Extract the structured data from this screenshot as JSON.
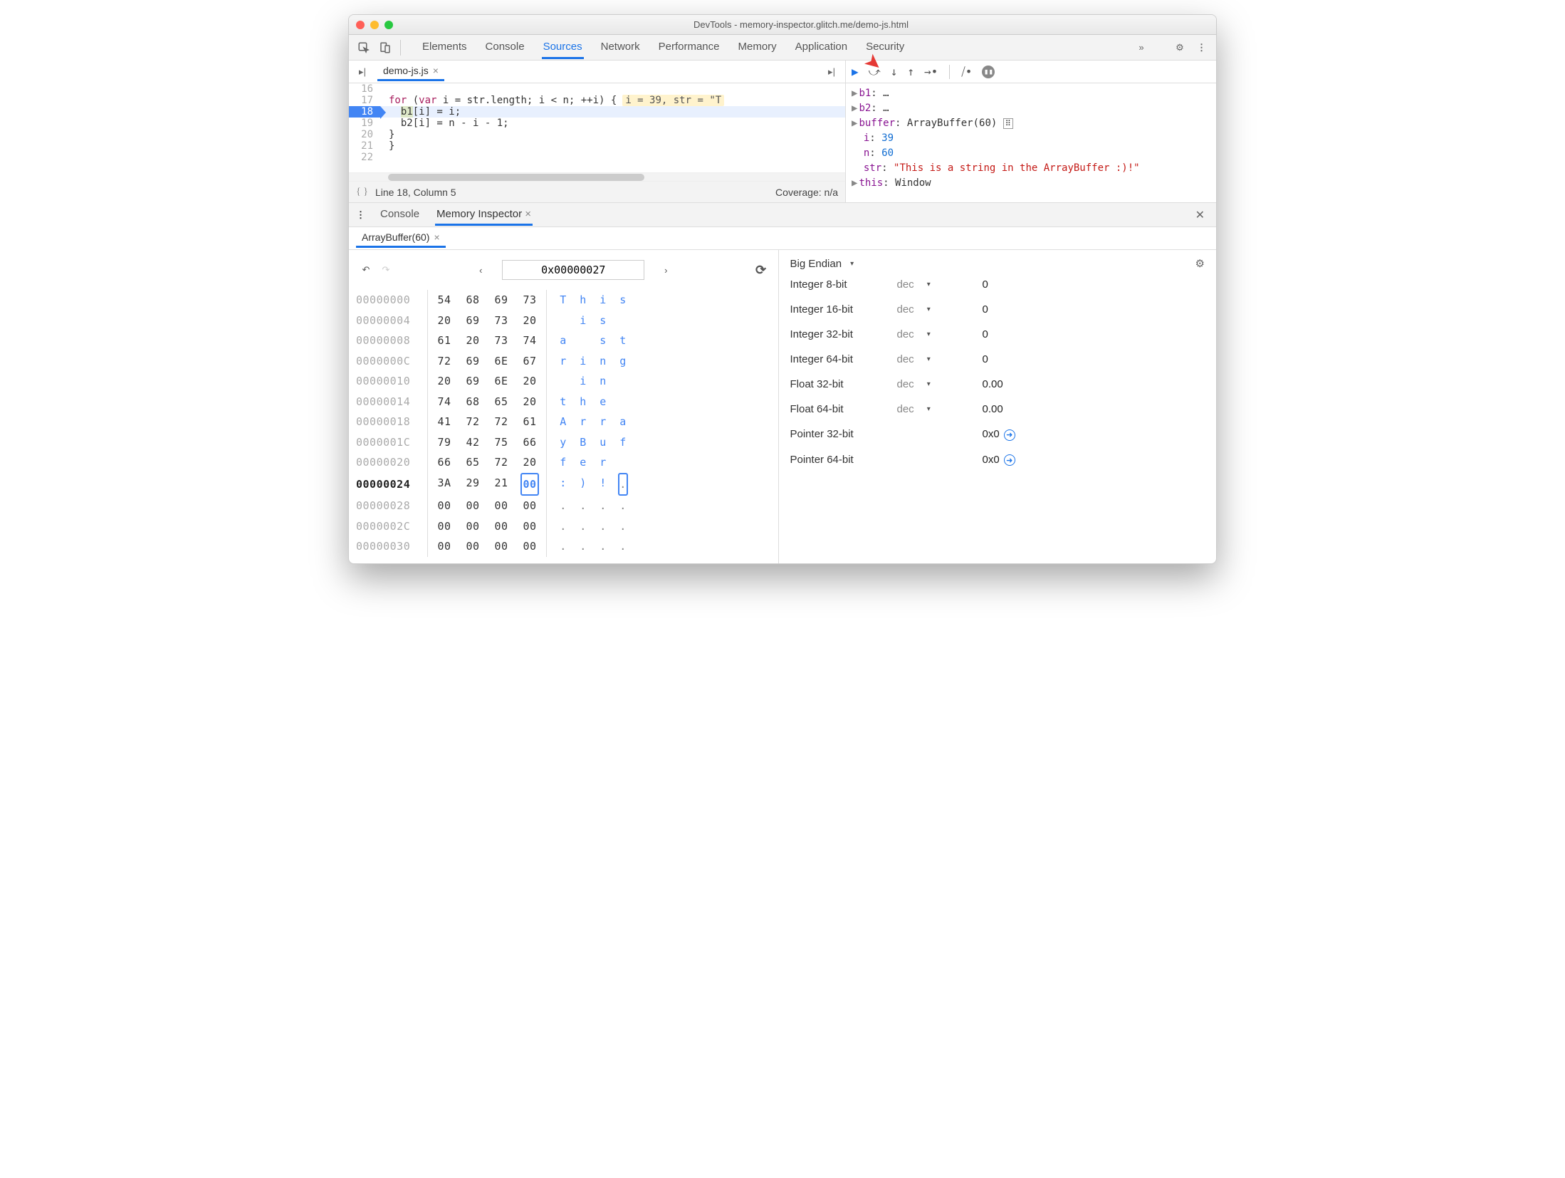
{
  "window": {
    "title": "DevTools - memory-inspector.glitch.me/demo-js.html"
  },
  "mainTabs": [
    "Elements",
    "Console",
    "Sources",
    "Network",
    "Performance",
    "Memory",
    "Application",
    "Security"
  ],
  "mainActive": "Sources",
  "file": {
    "name": "demo-js.js"
  },
  "code": {
    "lines": [
      {
        "n": 16,
        "t": ""
      },
      {
        "n": 17,
        "t": "for (var i = str.length; i < n; ++i) {",
        "eval": "i = 39, str = \"T"
      },
      {
        "n": 18,
        "t": "  b1[i] = i;",
        "bp": true,
        "hl": true,
        "hlTok": "b1"
      },
      {
        "n": 19,
        "t": "  b2[i] = n - i - 1;"
      },
      {
        "n": 20,
        "t": "}"
      },
      {
        "n": 21,
        "t": "}"
      },
      {
        "n": 22,
        "t": ""
      }
    ],
    "status": "Line 18, Column 5",
    "coverage": "Coverage: n/a"
  },
  "scope": {
    "b1": "…",
    "b2": "…",
    "buffer": "ArrayBuffer(60)",
    "i": 39,
    "n": 60,
    "str": "\"This is a string in the ArrayBuffer :)!\"",
    "this": "Window"
  },
  "drawer": {
    "tabs": [
      "Console",
      "Memory Inspector"
    ],
    "active": "Memory Inspector"
  },
  "mi": {
    "tab": "ArrayBuffer(60)",
    "address": "0x00000027",
    "rows": [
      {
        "a": "00000000",
        "b": [
          "54",
          "68",
          "69",
          "73"
        ],
        "c": [
          "T",
          "h",
          "i",
          "s"
        ]
      },
      {
        "a": "00000004",
        "b": [
          "20",
          "69",
          "73",
          "20"
        ],
        "c": [
          " ",
          "i",
          "s",
          " "
        ]
      },
      {
        "a": "00000008",
        "b": [
          "61",
          "20",
          "73",
          "74"
        ],
        "c": [
          "a",
          " ",
          "s",
          "t"
        ]
      },
      {
        "a": "0000000C",
        "b": [
          "72",
          "69",
          "6E",
          "67"
        ],
        "c": [
          "r",
          "i",
          "n",
          "g"
        ]
      },
      {
        "a": "00000010",
        "b": [
          "20",
          "69",
          "6E",
          "20"
        ],
        "c": [
          " ",
          "i",
          "n",
          " "
        ]
      },
      {
        "a": "00000014",
        "b": [
          "74",
          "68",
          "65",
          "20"
        ],
        "c": [
          "t",
          "h",
          "e",
          " "
        ]
      },
      {
        "a": "00000018",
        "b": [
          "41",
          "72",
          "72",
          "61"
        ],
        "c": [
          "A",
          "r",
          "r",
          "a"
        ]
      },
      {
        "a": "0000001C",
        "b": [
          "79",
          "42",
          "75",
          "66"
        ],
        "c": [
          "y",
          "B",
          "u",
          "f"
        ]
      },
      {
        "a": "00000020",
        "b": [
          "66",
          "65",
          "72",
          "20"
        ],
        "c": [
          "f",
          "e",
          "r",
          " "
        ]
      },
      {
        "a": "00000024",
        "b": [
          "3A",
          "29",
          "21",
          "00"
        ],
        "c": [
          ":",
          ")",
          "!",
          "."
        ],
        "cur": true,
        "sel": 3
      },
      {
        "a": "00000028",
        "b": [
          "00",
          "00",
          "00",
          "00"
        ],
        "c": [
          ".",
          ".",
          ".",
          "."
        ]
      },
      {
        "a": "0000002C",
        "b": [
          "00",
          "00",
          "00",
          "00"
        ],
        "c": [
          ".",
          ".",
          ".",
          "."
        ]
      },
      {
        "a": "00000030",
        "b": [
          "00",
          "00",
          "00",
          "00"
        ],
        "c": [
          ".",
          ".",
          ".",
          "."
        ]
      }
    ]
  },
  "values": {
    "endian": "Big Endian",
    "rows": [
      {
        "label": "Integer 8-bit",
        "mode": "dec",
        "val": "0"
      },
      {
        "label": "Integer 16-bit",
        "mode": "dec",
        "val": "0"
      },
      {
        "label": "Integer 32-bit",
        "mode": "dec",
        "val": "0"
      },
      {
        "label": "Integer 64-bit",
        "mode": "dec",
        "val": "0"
      },
      {
        "label": "Float 32-bit",
        "mode": "dec",
        "val": "0.00"
      },
      {
        "label": "Float 64-bit",
        "mode": "dec",
        "val": "0.00"
      },
      {
        "label": "Pointer 32-bit",
        "mode": "",
        "val": "0x0",
        "follow": true
      },
      {
        "label": "Pointer 64-bit",
        "mode": "",
        "val": "0x0",
        "follow": true
      }
    ]
  }
}
